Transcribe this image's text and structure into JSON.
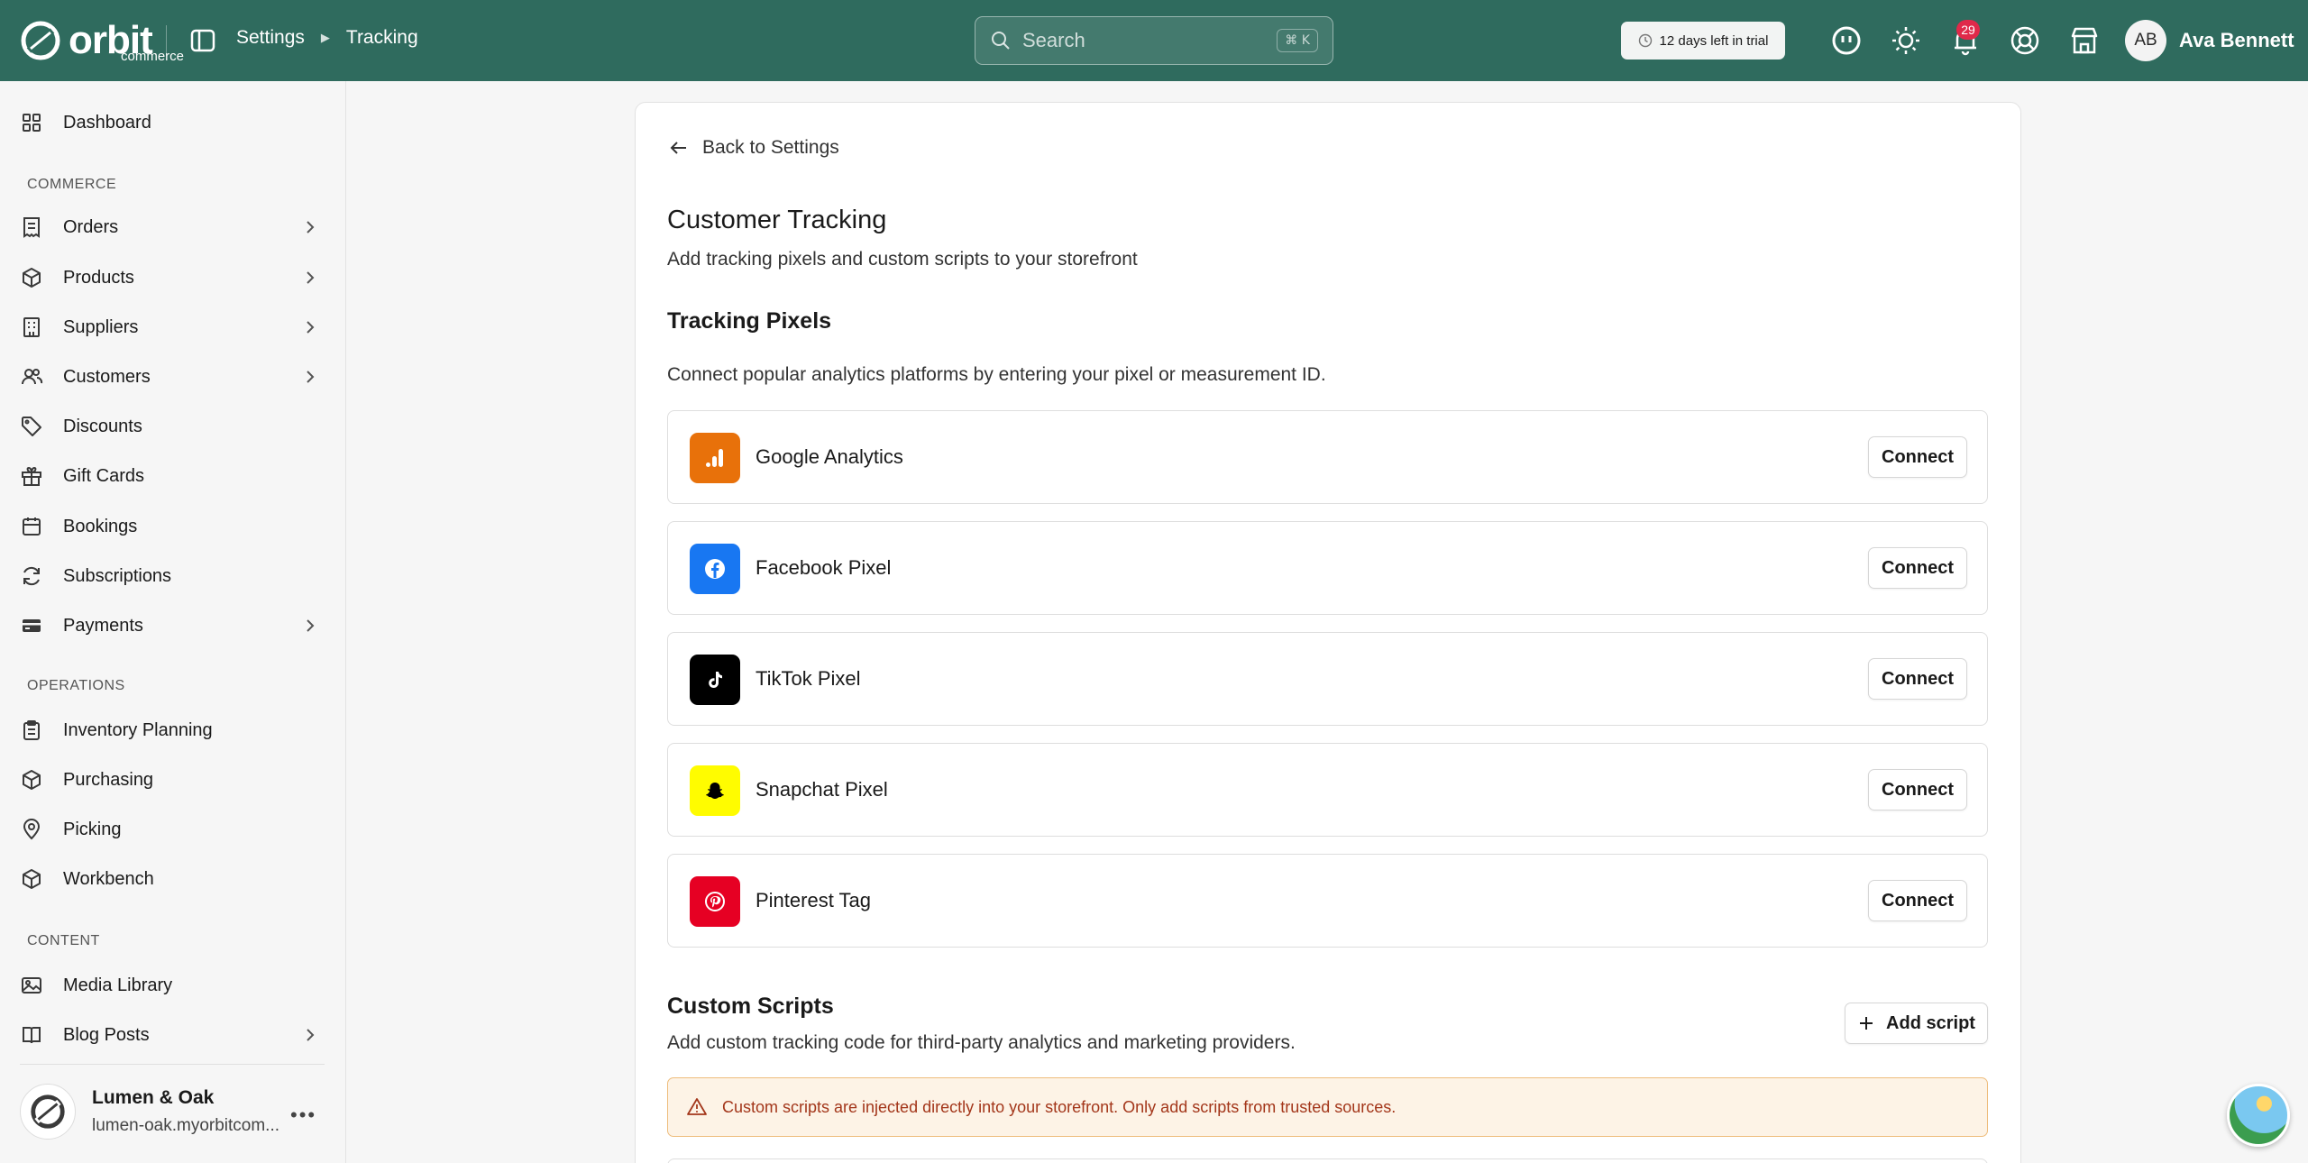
{
  "brand": {
    "name": "orbit",
    "sub": "commerce"
  },
  "breadcrumb": {
    "parent": "Settings",
    "current": "Tracking"
  },
  "search": {
    "placeholder": "Search",
    "shortcut": "⌘ K"
  },
  "trial": {
    "text": "12 days left in trial"
  },
  "notifications": {
    "count": "29"
  },
  "user": {
    "initials": "AB",
    "name": "Ava Bennett"
  },
  "sidebar": {
    "dashboard": "Dashboard",
    "commerce_label": "COMMERCE",
    "commerce": [
      "Orders",
      "Products",
      "Suppliers",
      "Customers",
      "Discounts",
      "Gift Cards",
      "Bookings",
      "Subscriptions",
      "Payments"
    ],
    "operations_label": "OPERATIONS",
    "operations": [
      "Inventory Planning",
      "Purchasing",
      "Picking",
      "Workbench"
    ],
    "content_label": "CONTENT",
    "content": [
      "Media Library",
      "Blog Posts"
    ]
  },
  "store": {
    "name": "Lumen & Oak",
    "domain": "lumen-oak.myorbitcom..."
  },
  "page": {
    "back": "Back to Settings",
    "title": "Customer Tracking",
    "subtitle": "Add tracking pixels and custom scripts to your storefront",
    "pixels_heading": "Tracking Pixels",
    "pixels_desc": "Connect popular analytics platforms by entering your pixel or measurement ID.",
    "pixels": [
      {
        "name": "Google Analytics",
        "action": "Connect",
        "color": "#e8710a"
      },
      {
        "name": "Facebook Pixel",
        "action": "Connect",
        "color": "#1877f2"
      },
      {
        "name": "TikTok Pixel",
        "action": "Connect",
        "color": "#000000"
      },
      {
        "name": "Snapchat Pixel",
        "action": "Connect",
        "color": "#fffc00"
      },
      {
        "name": "Pinterest Tag",
        "action": "Connect",
        "color": "#e60023"
      }
    ],
    "scripts_heading": "Custom Scripts",
    "scripts_desc": "Add custom tracking code for third-party analytics and marketing providers.",
    "add_script": "Add script",
    "warning": "Custom scripts are injected directly into your storefront. Only add scripts from trusted sources."
  },
  "colors": {
    "topbar": "#2f6b5e",
    "badge": "#e0294a",
    "warning_text": "#a3361a",
    "warning_bg": "#fdf3e6"
  }
}
